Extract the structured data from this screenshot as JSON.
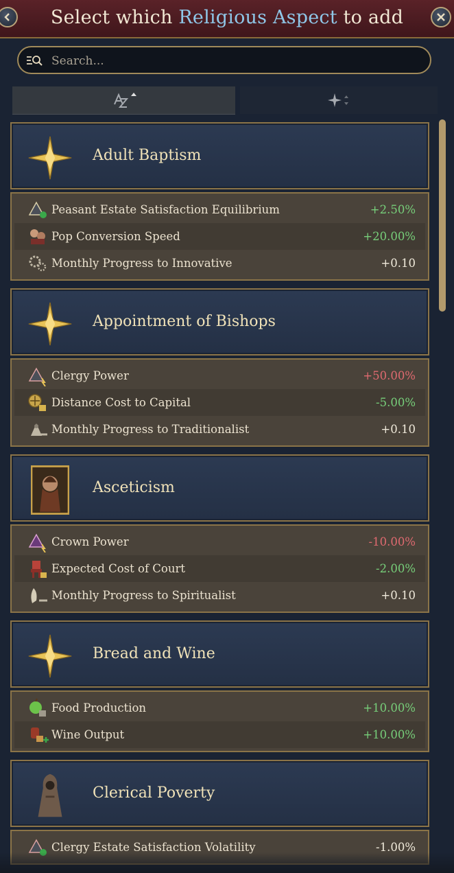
{
  "header": {
    "title_pre": "Select which ",
    "title_highlight": "Religious Aspect",
    "title_post": " to add"
  },
  "search": {
    "placeholder": "Search..."
  },
  "aspects": [
    {
      "name": "Adult Baptism",
      "icon": "gold-star-icon",
      "effects": [
        {
          "icon": "estate-satisfaction-icon",
          "label": "Peasant Estate Satisfaction Equilibrium",
          "value": "+2.50%",
          "tone": "pos"
        },
        {
          "icon": "pop-conversion-icon",
          "label": "Pop Conversion Speed",
          "value": "+20.00%",
          "tone": "pos"
        },
        {
          "icon": "innovative-progress-icon",
          "label": "Monthly Progress to Innovative",
          "value": "+0.10",
          "tone": "neu"
        }
      ]
    },
    {
      "name": "Appointment of Bishops",
      "icon": "gold-star-icon",
      "effects": [
        {
          "icon": "clergy-power-icon",
          "label": "Clergy Power",
          "value": "+50.00%",
          "tone": "neg"
        },
        {
          "icon": "distance-cost-icon",
          "label": "Distance Cost to Capital",
          "value": "-5.00%",
          "tone": "pos"
        },
        {
          "icon": "traditionalist-progress-icon",
          "label": "Monthly Progress to Traditionalist",
          "value": "+0.10",
          "tone": "neu"
        }
      ]
    },
    {
      "name": "Asceticism",
      "icon": "portrait-icon",
      "effects": [
        {
          "icon": "crown-power-icon",
          "label": "Crown Power",
          "value": "-10.00%",
          "tone": "neg"
        },
        {
          "icon": "court-cost-icon",
          "label": "Expected Cost of Court",
          "value": "-2.00%",
          "tone": "pos"
        },
        {
          "icon": "spiritualist-progress-icon",
          "label": "Monthly Progress to Spiritualist",
          "value": "+0.10",
          "tone": "neu"
        }
      ]
    },
    {
      "name": "Bread and Wine",
      "icon": "gold-star-icon",
      "effects": [
        {
          "icon": "food-production-icon",
          "label": "Food Production",
          "value": "+10.00%",
          "tone": "pos"
        },
        {
          "icon": "wine-output-icon",
          "label": "Wine Output",
          "value": "+10.00%",
          "tone": "pos"
        }
      ]
    },
    {
      "name": "Clerical Poverty",
      "icon": "monk-icon",
      "effects": [
        {
          "icon": "clergy-satisfaction-icon",
          "label": "Clergy Estate Satisfaction Volatility",
          "value": "-1.00%",
          "tone": "neu"
        }
      ]
    }
  ]
}
